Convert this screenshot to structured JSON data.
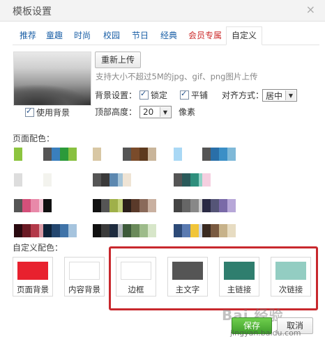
{
  "window": {
    "title": "模板设置",
    "close_icon": "×"
  },
  "tabs": [
    "推荐",
    "童趣",
    "时尚",
    "校园",
    "节日",
    "经典",
    "会员专属",
    "自定义"
  ],
  "upload": {
    "reupload_label": "重新上传",
    "hint": "支持大小不超过5M的jpg、gif、png图片上传",
    "use_bg_label": "使用背景",
    "use_bg_checked": true
  },
  "bg_settings": {
    "label": "背景设置：",
    "lock_label": "锁定",
    "lock_checked": true,
    "tile_label": "平铺",
    "tile_checked": true,
    "align_label": "对齐方式：",
    "align_value": "居中",
    "top_height_label": "顶部高度：",
    "top_height_value": "20",
    "unit": "像素"
  },
  "page_colors": {
    "label": "页面配色：",
    "palettes": [
      [
        "#8cc43f",
        "#ffffff",
        "#ffffff",
        "#ffffff",
        "#ffffff",
        "#ffffff"
      ],
      [
        "#555555",
        "#3a7fbd",
        "#2c9a3a",
        "#88c040",
        "#ffffff",
        "#ffffff"
      ],
      [
        "#d8c7a4",
        "#ffffff",
        "#ffffff",
        "#ffffff",
        "#ffffff",
        "#ffffff"
      ],
      [
        "#555555",
        "#7a4b2a",
        "#5d3a1e",
        "#c9b59a",
        "#ffffff",
        "#ffffff"
      ],
      [
        "#a9d8f5",
        "#ffffff",
        "#ffffff",
        "#ffffff",
        "#ffffff",
        "#ffffff"
      ],
      [
        "#555555",
        "#2a6fa8",
        "#3b8fc6",
        "#7fb9d8",
        "#ffffff",
        "#ffffff"
      ],
      [
        "#dddddd",
        "#ffffff",
        "#ffffff",
        "#ffffff",
        "#2d63b8",
        "#c8232c"
      ],
      [
        "#f3f3ee",
        "#ffffff",
        "#ffffff",
        "#ffffff",
        "#ffffff",
        "#ffffff"
      ],
      [
        "#555555",
        "#3a3a3a",
        "#5c88b0",
        "#a5c4d8",
        "#ffffff",
        "#ffffff"
      ],
      [
        "#efe4d5",
        "#ffffff",
        "#ffffff",
        "#ffffff",
        "#ffffff",
        "#ffffff"
      ],
      [
        "#555555",
        "#2a5a5a",
        "#2f8f7d",
        "#8fd3c6",
        "#ffffff",
        "#ffffff"
      ],
      [
        "#f5cfe0",
        "#ffffff",
        "#ffffff",
        "#ffffff",
        "#ffffff",
        "#ffffff"
      ],
      [
        "#555555",
        "#d4507a",
        "#e889a9",
        "#f2c3d3",
        "#ffffff",
        "#ffffff"
      ],
      [
        "#111111",
        "#ffffff",
        "#ffffff",
        "#ffffff",
        "#ffffff",
        "#ffffff"
      ],
      [
        "#111111",
        "#555555",
        "#9fb04a",
        "#c3d17a",
        "#ffffff",
        "#ffffff"
      ],
      [
        "#2b1f1a",
        "#5a3a2a",
        "#8a6a5a",
        "#c9b0a0",
        "#ffffff",
        "#ffffff"
      ],
      [
        "#444444",
        "#666666",
        "#888888",
        "#cccccc",
        "#ffffff",
        "#ffffff"
      ],
      [
        "#2a2a44",
        "#555577",
        "#7a6aa8",
        "#b7a7d8",
        "#ffffff",
        "#ffffff"
      ],
      [
        "#2a0a10",
        "#6b1a24",
        "#b33a4a",
        "#d99aa5",
        "#ffffff",
        "#ffffff"
      ],
      [
        "#0e2238",
        "#24476f",
        "#3f73a8",
        "#a6c4de",
        "#ffffff",
        "#ffffff"
      ],
      [
        "#111111",
        "#3a3a3a",
        "#1e2c3f",
        "#b0b6bd",
        "#ffffff",
        "#ffffff"
      ],
      [
        "#3d5a3a",
        "#6a8a5a",
        "#9dbb8a",
        "#d7e6c9",
        "#ffffff",
        "#ffffff"
      ],
      [
        "#2d4a77",
        "#5a7ab0",
        "#f1c53a",
        "#cbd6e8",
        "#ffffff",
        "#ffffff"
      ],
      [
        "#3a2a20",
        "#7a5a40",
        "#c7b28a",
        "#e7dcc2",
        "#ffffff",
        "#ffffff"
      ]
    ]
  },
  "custom_colors": {
    "label": "自定义配色：",
    "items": [
      {
        "label": "页面背景",
        "color": "#e8212e"
      },
      {
        "label": "内容背景",
        "color": "#ffffff"
      },
      {
        "label": "边框",
        "color": "#ffffff"
      },
      {
        "label": "主文字",
        "color": "#555555"
      },
      {
        "label": "主链接",
        "color": "#2f7e6e"
      },
      {
        "label": "次链接",
        "color": "#93cdc2"
      }
    ]
  },
  "footer": {
    "save_label": "保存",
    "cancel_label": "取消"
  },
  "watermark": {
    "main": "Bai 经验",
    "sub": "jingyan.baidu.com"
  }
}
